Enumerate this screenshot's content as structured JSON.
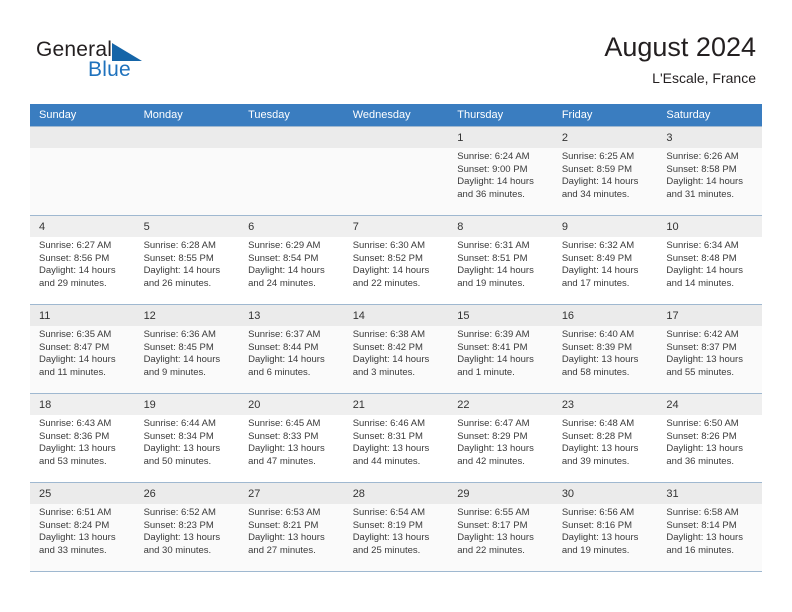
{
  "brand": {
    "name_part1": "General",
    "name_part2": "Blue"
  },
  "header": {
    "title": "August 2024",
    "subtitle": "L'Escale, France"
  },
  "colors": {
    "header_row": "#3a7dc0",
    "brand_blue": "#1f72bd",
    "grid_line": "#9fb8d0",
    "daynum_bg": "#efefef"
  },
  "weekdays": [
    "Sunday",
    "Monday",
    "Tuesday",
    "Wednesday",
    "Thursday",
    "Friday",
    "Saturday"
  ],
  "weeks": [
    [
      {
        "day": "",
        "sunrise": "",
        "sunset": "",
        "daylight1": "",
        "daylight2": ""
      },
      {
        "day": "",
        "sunrise": "",
        "sunset": "",
        "daylight1": "",
        "daylight2": ""
      },
      {
        "day": "",
        "sunrise": "",
        "sunset": "",
        "daylight1": "",
        "daylight2": ""
      },
      {
        "day": "",
        "sunrise": "",
        "sunset": "",
        "daylight1": "",
        "daylight2": ""
      },
      {
        "day": "1",
        "sunrise": "Sunrise: 6:24 AM",
        "sunset": "Sunset: 9:00 PM",
        "daylight1": "Daylight: 14 hours",
        "daylight2": "and 36 minutes."
      },
      {
        "day": "2",
        "sunrise": "Sunrise: 6:25 AM",
        "sunset": "Sunset: 8:59 PM",
        "daylight1": "Daylight: 14 hours",
        "daylight2": "and 34 minutes."
      },
      {
        "day": "3",
        "sunrise": "Sunrise: 6:26 AM",
        "sunset": "Sunset: 8:58 PM",
        "daylight1": "Daylight: 14 hours",
        "daylight2": "and 31 minutes."
      }
    ],
    [
      {
        "day": "4",
        "sunrise": "Sunrise: 6:27 AM",
        "sunset": "Sunset: 8:56 PM",
        "daylight1": "Daylight: 14 hours",
        "daylight2": "and 29 minutes."
      },
      {
        "day": "5",
        "sunrise": "Sunrise: 6:28 AM",
        "sunset": "Sunset: 8:55 PM",
        "daylight1": "Daylight: 14 hours",
        "daylight2": "and 26 minutes."
      },
      {
        "day": "6",
        "sunrise": "Sunrise: 6:29 AM",
        "sunset": "Sunset: 8:54 PM",
        "daylight1": "Daylight: 14 hours",
        "daylight2": "and 24 minutes."
      },
      {
        "day": "7",
        "sunrise": "Sunrise: 6:30 AM",
        "sunset": "Sunset: 8:52 PM",
        "daylight1": "Daylight: 14 hours",
        "daylight2": "and 22 minutes."
      },
      {
        "day": "8",
        "sunrise": "Sunrise: 6:31 AM",
        "sunset": "Sunset: 8:51 PM",
        "daylight1": "Daylight: 14 hours",
        "daylight2": "and 19 minutes."
      },
      {
        "day": "9",
        "sunrise": "Sunrise: 6:32 AM",
        "sunset": "Sunset: 8:49 PM",
        "daylight1": "Daylight: 14 hours",
        "daylight2": "and 17 minutes."
      },
      {
        "day": "10",
        "sunrise": "Sunrise: 6:34 AM",
        "sunset": "Sunset: 8:48 PM",
        "daylight1": "Daylight: 14 hours",
        "daylight2": "and 14 minutes."
      }
    ],
    [
      {
        "day": "11",
        "sunrise": "Sunrise: 6:35 AM",
        "sunset": "Sunset: 8:47 PM",
        "daylight1": "Daylight: 14 hours",
        "daylight2": "and 11 minutes."
      },
      {
        "day": "12",
        "sunrise": "Sunrise: 6:36 AM",
        "sunset": "Sunset: 8:45 PM",
        "daylight1": "Daylight: 14 hours",
        "daylight2": "and 9 minutes."
      },
      {
        "day": "13",
        "sunrise": "Sunrise: 6:37 AM",
        "sunset": "Sunset: 8:44 PM",
        "daylight1": "Daylight: 14 hours",
        "daylight2": "and 6 minutes."
      },
      {
        "day": "14",
        "sunrise": "Sunrise: 6:38 AM",
        "sunset": "Sunset: 8:42 PM",
        "daylight1": "Daylight: 14 hours",
        "daylight2": "and 3 minutes."
      },
      {
        "day": "15",
        "sunrise": "Sunrise: 6:39 AM",
        "sunset": "Sunset: 8:41 PM",
        "daylight1": "Daylight: 14 hours",
        "daylight2": "and 1 minute."
      },
      {
        "day": "16",
        "sunrise": "Sunrise: 6:40 AM",
        "sunset": "Sunset: 8:39 PM",
        "daylight1": "Daylight: 13 hours",
        "daylight2": "and 58 minutes."
      },
      {
        "day": "17",
        "sunrise": "Sunrise: 6:42 AM",
        "sunset": "Sunset: 8:37 PM",
        "daylight1": "Daylight: 13 hours",
        "daylight2": "and 55 minutes."
      }
    ],
    [
      {
        "day": "18",
        "sunrise": "Sunrise: 6:43 AM",
        "sunset": "Sunset: 8:36 PM",
        "daylight1": "Daylight: 13 hours",
        "daylight2": "and 53 minutes."
      },
      {
        "day": "19",
        "sunrise": "Sunrise: 6:44 AM",
        "sunset": "Sunset: 8:34 PM",
        "daylight1": "Daylight: 13 hours",
        "daylight2": "and 50 minutes."
      },
      {
        "day": "20",
        "sunrise": "Sunrise: 6:45 AM",
        "sunset": "Sunset: 8:33 PM",
        "daylight1": "Daylight: 13 hours",
        "daylight2": "and 47 minutes."
      },
      {
        "day": "21",
        "sunrise": "Sunrise: 6:46 AM",
        "sunset": "Sunset: 8:31 PM",
        "daylight1": "Daylight: 13 hours",
        "daylight2": "and 44 minutes."
      },
      {
        "day": "22",
        "sunrise": "Sunrise: 6:47 AM",
        "sunset": "Sunset: 8:29 PM",
        "daylight1": "Daylight: 13 hours",
        "daylight2": "and 42 minutes."
      },
      {
        "day": "23",
        "sunrise": "Sunrise: 6:48 AM",
        "sunset": "Sunset: 8:28 PM",
        "daylight1": "Daylight: 13 hours",
        "daylight2": "and 39 minutes."
      },
      {
        "day": "24",
        "sunrise": "Sunrise: 6:50 AM",
        "sunset": "Sunset: 8:26 PM",
        "daylight1": "Daylight: 13 hours",
        "daylight2": "and 36 minutes."
      }
    ],
    [
      {
        "day": "25",
        "sunrise": "Sunrise: 6:51 AM",
        "sunset": "Sunset: 8:24 PM",
        "daylight1": "Daylight: 13 hours",
        "daylight2": "and 33 minutes."
      },
      {
        "day": "26",
        "sunrise": "Sunrise: 6:52 AM",
        "sunset": "Sunset: 8:23 PM",
        "daylight1": "Daylight: 13 hours",
        "daylight2": "and 30 minutes."
      },
      {
        "day": "27",
        "sunrise": "Sunrise: 6:53 AM",
        "sunset": "Sunset: 8:21 PM",
        "daylight1": "Daylight: 13 hours",
        "daylight2": "and 27 minutes."
      },
      {
        "day": "28",
        "sunrise": "Sunrise: 6:54 AM",
        "sunset": "Sunset: 8:19 PM",
        "daylight1": "Daylight: 13 hours",
        "daylight2": "and 25 minutes."
      },
      {
        "day": "29",
        "sunrise": "Sunrise: 6:55 AM",
        "sunset": "Sunset: 8:17 PM",
        "daylight1": "Daylight: 13 hours",
        "daylight2": "and 22 minutes."
      },
      {
        "day": "30",
        "sunrise": "Sunrise: 6:56 AM",
        "sunset": "Sunset: 8:16 PM",
        "daylight1": "Daylight: 13 hours",
        "daylight2": "and 19 minutes."
      },
      {
        "day": "31",
        "sunrise": "Sunrise: 6:58 AM",
        "sunset": "Sunset: 8:14 PM",
        "daylight1": "Daylight: 13 hours",
        "daylight2": "and 16 minutes."
      }
    ]
  ]
}
